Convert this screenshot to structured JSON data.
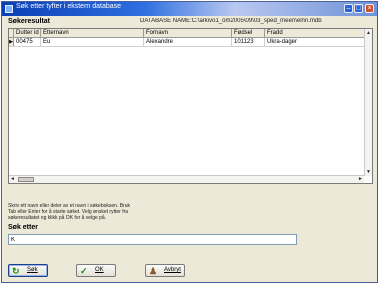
{
  "window": {
    "title": "Søk etter tyfter i ekstern database",
    "buttons": [
      "minimize",
      "maximize",
      "close"
    ]
  },
  "header": {
    "label": "Søkeresultat",
    "db_path": "DATABASE NAME:C:\\arkivo1_om2005\\09\\03_sped_meen\\elnn.mdb"
  },
  "grid": {
    "columns": [
      "Dutter id",
      "Etternavn",
      "Fornavn",
      "Fødsel",
      "Fradd"
    ],
    "rows": [
      {
        "indicator": "▶",
        "cells": [
          "00475",
          "Eu",
          "Alexandre",
          "101123",
          "Ukra-dager"
        ]
      }
    ]
  },
  "instructions": {
    "line1": "Skriv ett navn eller deler av et navn i søkeboksen. Bruk",
    "line2": "Tab eller Enter for å starte søket. Velg ønsket rytter fra",
    "line3": "søkeresultatet og klikk på OK for å velge på."
  },
  "search": {
    "label": "Søk etter",
    "value": "K"
  },
  "buttons": {
    "search": "Søk",
    "ok": "OK",
    "cancel": "Avbryt"
  },
  "colors": {
    "title_blue": "#0a3fb5",
    "window_bg": "#ece9d8",
    "ok_check": "#1a8f1a",
    "cancel_icon": "#8a5a2b"
  }
}
